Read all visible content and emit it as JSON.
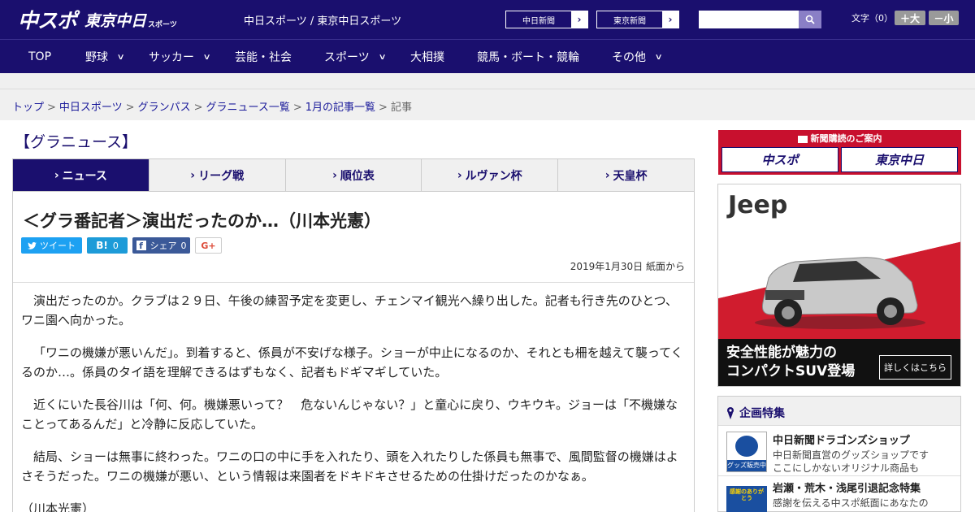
{
  "header": {
    "logo_main": "中スポ",
    "logo_sub": "東京中日",
    "logo_small": "スポーツ",
    "site_names": "中日スポーツ / 東京中日スポーツ",
    "btn_chunichi": "中日新聞",
    "btn_tokyo": "東京新聞",
    "search_placeholder": "",
    "font_label": "文字（0）",
    "font_larger": "＋大",
    "font_smaller": "－小"
  },
  "nav": {
    "items": [
      {
        "label": "TOP",
        "has_menu": false
      },
      {
        "label": "野球",
        "has_menu": true
      },
      {
        "label": "サッカー",
        "has_menu": true
      },
      {
        "label": "芸能・社会",
        "has_menu": false
      },
      {
        "label": "スポーツ",
        "has_menu": true
      },
      {
        "label": "大相撲",
        "has_menu": false
      },
      {
        "label": "競馬・ボート・競輪",
        "has_menu": false
      },
      {
        "label": "その他",
        "has_menu": true
      }
    ]
  },
  "breadcrumb": {
    "items": [
      "トップ",
      "中日スポーツ",
      "グランパス",
      "グラニュース一覧",
      "1月の記事一覧"
    ],
    "current": "記事",
    "separator": ">"
  },
  "section_title": "【グラニュース】",
  "tabs": [
    {
      "label": "ニュース",
      "active": true
    },
    {
      "label": "リーグ戦",
      "active": false
    },
    {
      "label": "順位表",
      "active": false
    },
    {
      "label": "ルヴァン杯",
      "active": false
    },
    {
      "label": "天皇杯",
      "active": false
    }
  ],
  "article": {
    "headline": "＜グラ番記者＞演出だったのか…（川本光憲）",
    "share": {
      "tweet": "ツイート",
      "hatena_count": "0",
      "facebook": "シェア",
      "facebook_count": "0",
      "gplus": "G+"
    },
    "date": "2019年1月30日 紙面から",
    "paragraphs": [
      "演出だったのか。クラブは２９日、午後の練習予定を変更し、チェンマイ観光へ繰り出した。記者も行き先のひとつ、ワニ園へ向かった。",
      "「ワニの機嫌が悪いんだ」。到着すると、係員が不安げな様子。ショーが中止になるのか、それとも柵を越えて襲ってくるのか…。係員のタイ語を理解できるはずもなく、記者もドギマギしていた。",
      "近くにいた長谷川は「何、何。機嫌悪いって？　危ないんじゃない？」と童心に戻り、ウキウキ。ジョーは「不機嫌なことってあるんだ」と冷静に反応していた。",
      "結局、ショーは無事に終わった。ワニの口の中に手を入れたり、頭を入れたりした係員も無事で、風間監督の機嫌はよさそうだった。ワニの機嫌が悪い、という情報は来園者をドキドキさせるための仕掛けだったのかなぁ。",
      "（川本光憲）"
    ]
  },
  "sidebar": {
    "subscribe_title": "新聞購読のご案内",
    "subscribe_btn1": "中スポ",
    "subscribe_btn2": "東京中日",
    "ad": {
      "brand": "Jeep",
      "line1": "安全性能が魅力の",
      "line2": "コンパクトSUV登場",
      "button": "詳しくはこちら"
    },
    "feature": {
      "title": "企画特集",
      "items": [
        {
          "title": "中日新聞ドラゴンズショップ",
          "desc1": "中日新聞直営のグッズショップです",
          "desc2": "ここにしかないオリジナル商品も",
          "thumb_text": "グッズ販売中"
        },
        {
          "title": "岩瀬・荒木・浅尾引退記念特集",
          "desc1": "感謝を伝える中スポ紙面にあなたの",
          "thumb_text": "感謝のありがとう"
        }
      ]
    }
  },
  "colors": {
    "brand_navy": "#1a0f6e",
    "red": "#c8102e",
    "twitter": "#1da1f2",
    "hatena": "#1d9bd8",
    "facebook": "#3b5998"
  }
}
